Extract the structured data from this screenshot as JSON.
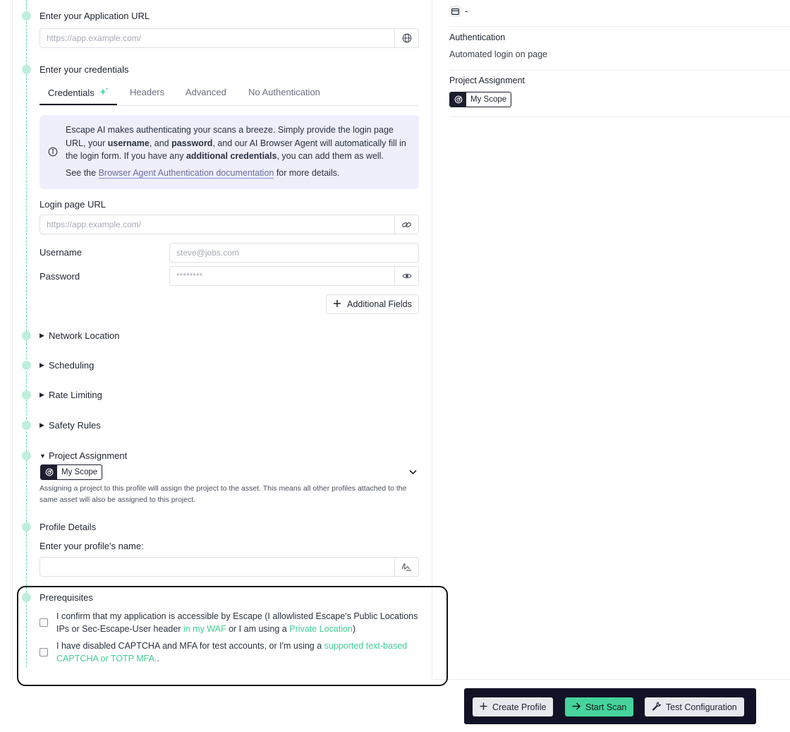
{
  "app": {
    "url_step": {
      "title": "Enter your Application URL",
      "placeholder": "https://app.example.com/",
      "icon": "globe-icon"
    },
    "credentials_step": {
      "title": "Enter your credentials",
      "tabs": [
        {
          "label": "Credentials",
          "active": true,
          "icon": "sparkle-icon"
        },
        {
          "label": "Headers",
          "active": false
        },
        {
          "label": "Advanced",
          "active": false
        },
        {
          "label": "No Authentication",
          "active": false
        }
      ],
      "info": {
        "l1_a": "Escape AI makes authenticating your scans a breeze. Simply provide the login page URL, your ",
        "l1_b": "username",
        "l1_c": ", and ",
        "l1_d": "password",
        "l1_e": ", and our AI Browser Agent will automatically fill in the login form. If you have any ",
        "l1_f": "additional credentials",
        "l1_g": ", you can add them as well.",
        "l2_a": "See the ",
        "l2_link": "Browser Agent Authentication documentation",
        "l2_b": " for more details."
      },
      "login_url": {
        "label": "Login page URL",
        "placeholder": "https://app.example.com/",
        "icon": "link-icon"
      },
      "username": {
        "label": "Username",
        "placeholder": "steve@jobs.com"
      },
      "password": {
        "label": "Password",
        "placeholder": "********",
        "icon": "eye-icon"
      },
      "additional_fields_label": "Additional Fields"
    },
    "sections": {
      "network_location": "Network Location",
      "scheduling": "Scheduling",
      "rate_limiting": "Rate Limiting",
      "safety_rules": "Safety Rules"
    },
    "project_assignment": {
      "title": "Project Assignment",
      "scope_label": "My Scope",
      "help": "Assigning a project to this profile will assign the project to the asset. This means all other profiles attached to the same asset will also be assigned to this project."
    },
    "profile_details": {
      "title": "Profile Details",
      "name_label": "Enter your profile's name:",
      "name_value": "",
      "icon": "signature-icon"
    },
    "prerequisites": {
      "title": "Prerequisites",
      "items": [
        {
          "a": "I confirm that my application is accessible by Escape (I allowlisted Escape's Public Locations IPs or Sec-Escape-User header ",
          "link1": "in my WAF",
          "b": " or I am using a ",
          "link2": "Private Location",
          "c": ")"
        },
        {
          "a": "I have disabled CAPTCHA and MFA for test accounts, or I'm using a ",
          "link1": "supported text-based CAPTCHA or TOTP MFA.",
          "b": "."
        }
      ]
    }
  },
  "summary": {
    "card_value": "-",
    "authentication_label": "Authentication",
    "authentication_value": "Automated login on page",
    "project_assignment_label": "Project Assignment",
    "scope_label": "My Scope"
  },
  "actions": {
    "create_profile": "Create Profile",
    "start_scan": "Start Scan",
    "test_configuration": "Test Configuration"
  },
  "colors": {
    "accent_green": "#46d39c",
    "dark_navy": "#111225",
    "info_bg": "#eeeffb"
  }
}
